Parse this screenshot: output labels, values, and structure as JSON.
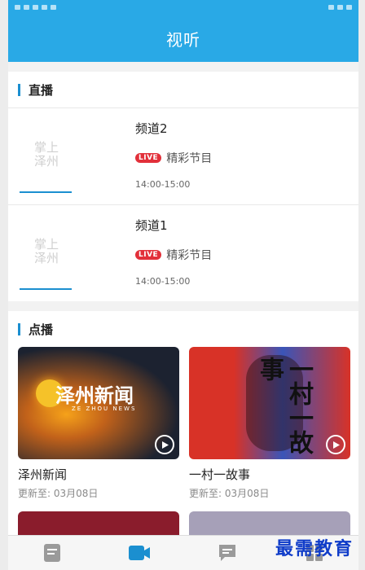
{
  "header": {
    "title": "视听"
  },
  "live": {
    "section_title": "直播",
    "items": [
      {
        "thumb_text_1": "掌上",
        "thumb_text_2": "泽州",
        "channel": "频道2",
        "badge": "LIVE",
        "program": "精彩节目",
        "time": "14:00-15:00"
      },
      {
        "thumb_text_1": "掌上",
        "thumb_text_2": "泽州",
        "channel": "频道1",
        "badge": "LIVE",
        "program": "精彩节目",
        "time": "14:00-15:00"
      }
    ]
  },
  "vod": {
    "section_title": "点播",
    "items": [
      {
        "title": "泽州新闻",
        "updated": "更新至: 03月08日",
        "poster_text": "泽州新闻",
        "poster_sub": "ZE ZHOU NEWS"
      },
      {
        "title": "一村一故事",
        "updated": "更新至: 03月08日",
        "poster_text": "一村一故事"
      }
    ]
  },
  "tabbar": {
    "icons": [
      "news-tab-icon",
      "video-tab-icon",
      "comment-tab-icon",
      "grid-tab-icon"
    ],
    "active_color": "#1b8fd0",
    "inactive_color": "#9a9a9a"
  },
  "watermark": "最需教育",
  "colors": {
    "header": "#29a9e6",
    "accent": "#1b8fd0",
    "live_badge": "#e2303a"
  }
}
